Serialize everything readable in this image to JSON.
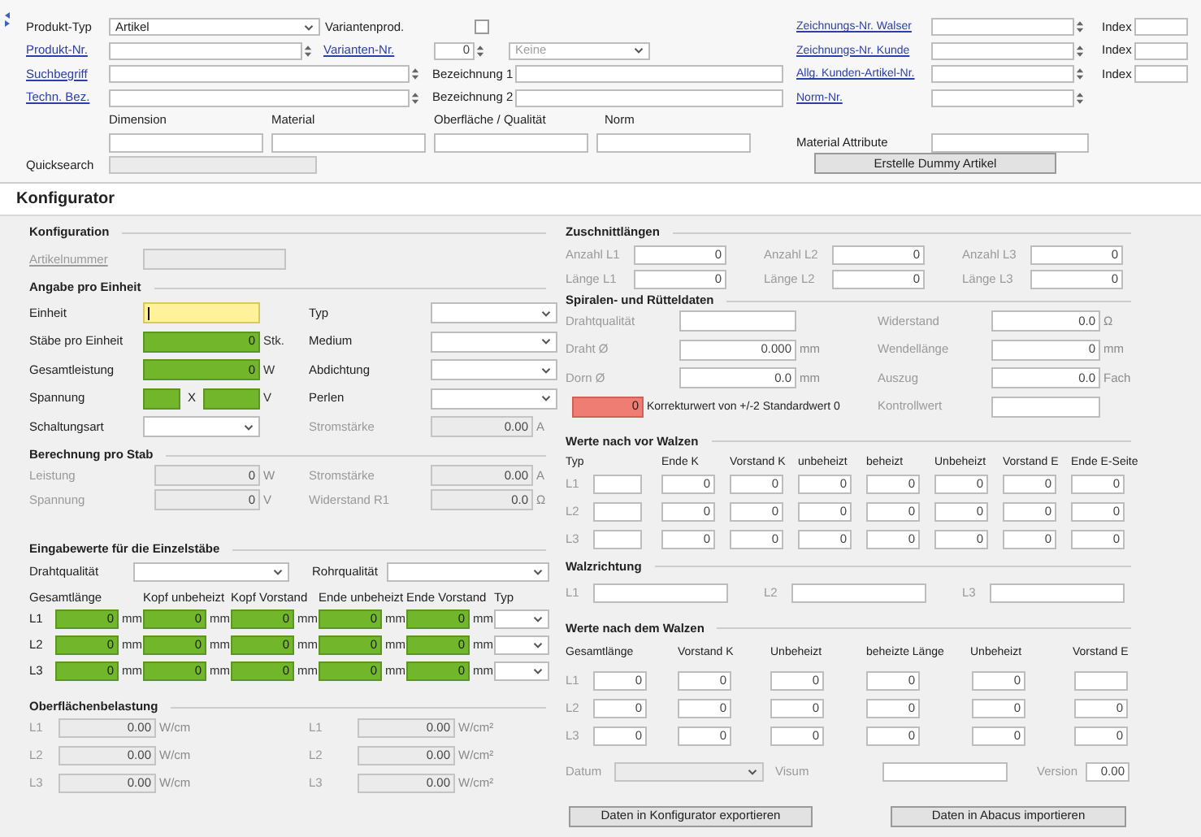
{
  "header": {
    "product_type": {
      "label": "Produkt-Typ",
      "value": "Artikel"
    },
    "variant_product": {
      "label": "Variantenprod.",
      "checked": false
    },
    "product_no": {
      "label": "Produkt-Nr."
    },
    "variant_no": {
      "label": "Varianten-Nr.",
      "value": "0"
    },
    "variant_option": {
      "placeholder": "Keine"
    },
    "search_term": {
      "label": "Suchbegriff"
    },
    "description_1": {
      "label": "Bezeichnung 1"
    },
    "tech_desc": {
      "label": "Techn. Bez."
    },
    "description_2": {
      "label": "Bezeichnung 2"
    },
    "attributes": [
      {
        "label": "Dimension"
      },
      {
        "label": "Material"
      },
      {
        "label": "Oberfläche / Qualität"
      },
      {
        "label": "Norm"
      }
    ],
    "quicksearch": {
      "label": "Quicksearch",
      "disabled": true
    },
    "numbers": [
      {
        "label": "Zeichnungs-Nr. Walser",
        "index_label": "Index"
      },
      {
        "label": "Zeichnungs-Nr. Kunde",
        "index_label": "Index"
      },
      {
        "label": "Allg. Kunden-Artikel-Nr.",
        "index_label": "Index"
      },
      {
        "label": "Norm-Nr."
      }
    ],
    "material_attribute": {
      "label": "Material Attribute"
    },
    "dummy_button": {
      "label": "Erstelle Dummy Artikel"
    }
  },
  "configurator": {
    "title": "Konfigurator",
    "configuration": {
      "title": "Konfiguration",
      "article_number": {
        "label": "Artikelnummer",
        "disabled": true
      }
    },
    "per_unit": {
      "title": "Angabe pro Einheit",
      "left": [
        {
          "kind": "input",
          "label": "Einheit",
          "focused": true
        },
        {
          "kind": "input",
          "label": "Stäbe pro Einheit",
          "value": "0",
          "unit": "Stk.",
          "valid": true
        },
        {
          "kind": "input",
          "label": "Gesamtleistung",
          "value": "0",
          "unit": "W",
          "valid": true
        },
        {
          "kind": "pair",
          "label": "Spannung",
          "separator": "X",
          "unit": "V",
          "valid": true
        },
        {
          "kind": "select",
          "label": "Schaltungsart"
        }
      ],
      "right": [
        {
          "kind": "select",
          "label": "Typ"
        },
        {
          "kind": "select",
          "label": "Medium"
        },
        {
          "kind": "select",
          "label": "Abdichtung"
        },
        {
          "kind": "select",
          "label": "Perlen"
        },
        {
          "kind": "input",
          "label": "Stromstärke",
          "value": "0.00",
          "unit": "A",
          "disabled": true
        }
      ]
    },
    "per_rod": {
      "title": "Berechnung pro Stab",
      "disabled": true,
      "left": [
        {
          "label": "Leistung",
          "value": "0",
          "unit": "W",
          "disabled": true
        },
        {
          "label": "Spannung",
          "value": "0",
          "unit": "V",
          "disabled": true
        }
      ],
      "right": [
        {
          "label": "Stromstärke",
          "value": "0.00",
          "unit": "A",
          "disabled": true
        },
        {
          "label": "Widerstand R1",
          "value": "0.0",
          "unit": "Ω",
          "disabled": true
        }
      ]
    },
    "single_rods": {
      "title": "Eingabewerte für die Einzelstäbe",
      "wire_quality": {
        "label": "Drahtqualität"
      },
      "tube_quality": {
        "label": "Rohrqualität"
      },
      "columns": [
        "Gesamtlänge",
        "Kopf unbeheizt",
        "Kopf Vorstand",
        "Ende unbeheizt",
        "Ende Vorstand",
        "Typ"
      ],
      "rows": [
        {
          "label": "L1",
          "values": [
            "0",
            "0",
            "0",
            "0",
            "0"
          ],
          "units": [
            "mm",
            "mm",
            "mm",
            "mm",
            "mm"
          ],
          "valid": true
        },
        {
          "label": "L2",
          "values": [
            "0",
            "0",
            "0",
            "0",
            "0"
          ],
          "units": [
            "mm",
            "mm",
            "mm",
            "mm",
            "mm"
          ],
          "valid": true
        },
        {
          "label": "L3",
          "values": [
            "0",
            "0",
            "0",
            "0",
            "0"
          ],
          "units": [
            "mm",
            "mm",
            "mm",
            "mm",
            "mm"
          ],
          "valid": true
        }
      ]
    },
    "surface_load": {
      "title": "Oberflächenbelastung",
      "disabled": true,
      "left": [
        {
          "label": "L1",
          "value": "0.00",
          "unit": "W/cm",
          "disabled": true
        },
        {
          "label": "L2",
          "value": "0.00",
          "unit": "W/cm",
          "disabled": true
        },
        {
          "label": "L3",
          "value": "0.00",
          "unit": "W/cm",
          "disabled": true
        }
      ],
      "right": [
        {
          "label": "L1",
          "value": "0.00",
          "unit": "W/cm²",
          "disabled": true
        },
        {
          "label": "L2",
          "value": "0.00",
          "unit": "W/cm²",
          "disabled": true
        },
        {
          "label": "L3",
          "value": "0.00",
          "unit": "W/cm²",
          "disabled": true
        }
      ]
    },
    "cut_lengths": {
      "title": "Zuschnittlängen",
      "disabled": true,
      "rows": [
        [
          {
            "label": "Anzahl L1",
            "value": "0"
          },
          {
            "label": "Anzahl L2",
            "value": "0"
          },
          {
            "label": "Anzahl L3",
            "value": "0"
          }
        ],
        [
          {
            "label": "Länge L1",
            "value": "0"
          },
          {
            "label": "Länge L2",
            "value": "0"
          },
          {
            "label": "Länge L3",
            "value": "0"
          }
        ]
      ]
    },
    "spirals": {
      "title": "Spiralen- und Rütteldaten",
      "disabled": true,
      "left": [
        {
          "kind": "input",
          "label": "Drahtqualität"
        },
        {
          "kind": "input",
          "label": "Draht Ø",
          "value": "0.000",
          "unit": "mm"
        },
        {
          "kind": "input",
          "label": "Dorn Ø",
          "value": "0.0",
          "unit": "mm"
        },
        {
          "kind": "note",
          "value": "0",
          "error": true,
          "text": "Korrekturwert von +/-2 Standardwert 0"
        }
      ],
      "right": [
        {
          "kind": "input",
          "label": "Widerstand",
          "value": "0.0",
          "unit": "Ω"
        },
        {
          "kind": "input",
          "label": "Wendellänge",
          "value": "0",
          "unit": "mm"
        },
        {
          "kind": "input",
          "label": "Auszug",
          "value": "0.0",
          "unit": "Fach"
        },
        {
          "kind": "input",
          "label": "Kontrollwert"
        }
      ]
    },
    "rolling_before": {
      "title": "Werte nach vor Walzen",
      "disabled": true,
      "columns": [
        "Typ",
        "Ende K",
        "Vorstand K",
        "unbeheizt",
        "beheizt",
        "Unbeheizt",
        "Vorstand E",
        "Ende E-Seite"
      ],
      "rows": [
        {
          "label": "L1",
          "values": [
            "0",
            "0",
            "0",
            "0",
            "0",
            "0",
            "0"
          ]
        },
        {
          "label": "L2",
          "values": [
            "0",
            "0",
            "0",
            "0",
            "0",
            "0",
            "0"
          ]
        },
        {
          "label": "L3",
          "values": [
            "0",
            "0",
            "0",
            "0",
            "0",
            "0",
            "0"
          ]
        }
      ]
    },
    "rolling_direction": {
      "title": "Walzrichtung",
      "disabled": true,
      "fields": [
        {
          "label": "L1"
        },
        {
          "label": "L2"
        },
        {
          "label": "L3"
        }
      ]
    },
    "rolling_after": {
      "title": "Werte nach dem Walzen",
      "disabled": true,
      "columns": [
        "Gesamtlänge",
        "Vorstand K",
        "Unbeheizt",
        "beheizte Länge",
        "Unbeheizt",
        "Vorstand E"
      ],
      "rows": [
        {
          "label": "L1",
          "values": [
            "0",
            "0",
            "0",
            "0",
            "0"
          ]
        },
        {
          "label": "L2",
          "values": [
            "0",
            "0",
            "0",
            "0",
            "0",
            "0"
          ]
        },
        {
          "label": "L3",
          "values": [
            "0",
            "0",
            "0",
            "0",
            "0",
            "0"
          ]
        }
      ]
    },
    "footer": {
      "disabled": true,
      "date": {
        "label": "Datum",
        "disabled": true
      },
      "visum": {
        "label": "Visum"
      },
      "version": {
        "label": "Version",
        "value": "0.00"
      }
    },
    "buttons": [
      {
        "label": "Daten in Konfigurator exportieren"
      },
      {
        "label": "Daten in Abacus importieren"
      }
    ]
  }
}
